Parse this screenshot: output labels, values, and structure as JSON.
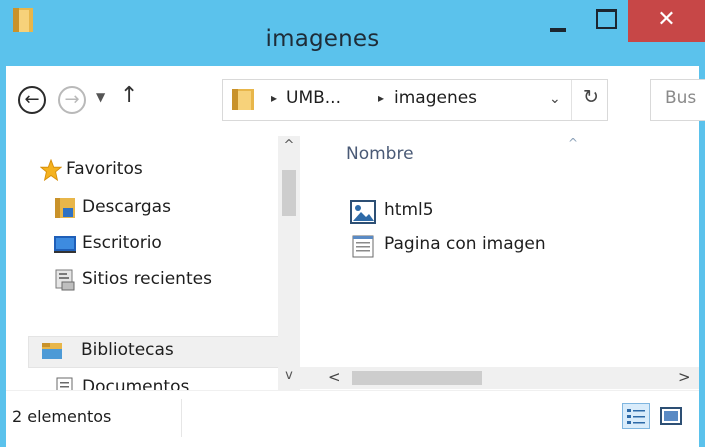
{
  "window": {
    "title": "imagenes",
    "close_glyph": "✕",
    "frame_color": "#5bc2ec",
    "close_color": "#c74747"
  },
  "nav": {
    "back_glyph": "←",
    "forward_glyph": "→",
    "recent_glyph": "▼",
    "up_glyph": "↑"
  },
  "address": {
    "separator": "▸",
    "crumbs": [
      "UMB...",
      "imagenes"
    ],
    "dropdown_glyph": "⌄",
    "refresh_glyph": "↻"
  },
  "search": {
    "placeholder": "Bus"
  },
  "navpane": {
    "items": [
      {
        "label": "Favoritos",
        "icon": "star-icon"
      },
      {
        "label": "Descargas",
        "icon": "downloads-folder-icon"
      },
      {
        "label": "Escritorio",
        "icon": "desktop-icon"
      },
      {
        "label": "Sitios recientes",
        "icon": "recent-places-icon"
      },
      {
        "label": "Bibliotecas",
        "icon": "libraries-icon"
      },
      {
        "label": "Documentos",
        "icon": "documents-icon"
      }
    ],
    "scroll_up": "^",
    "scroll_down": "v"
  },
  "content": {
    "column_header": "Nombre",
    "sort_glyph": "^",
    "files": [
      {
        "name": "html5",
        "icon": "image-file-icon"
      },
      {
        "name": "Pagina con imagen",
        "icon": "text-document-icon"
      }
    ],
    "scroll_left": "<",
    "scroll_right": ">"
  },
  "status": {
    "item_count": "2 elementos"
  }
}
